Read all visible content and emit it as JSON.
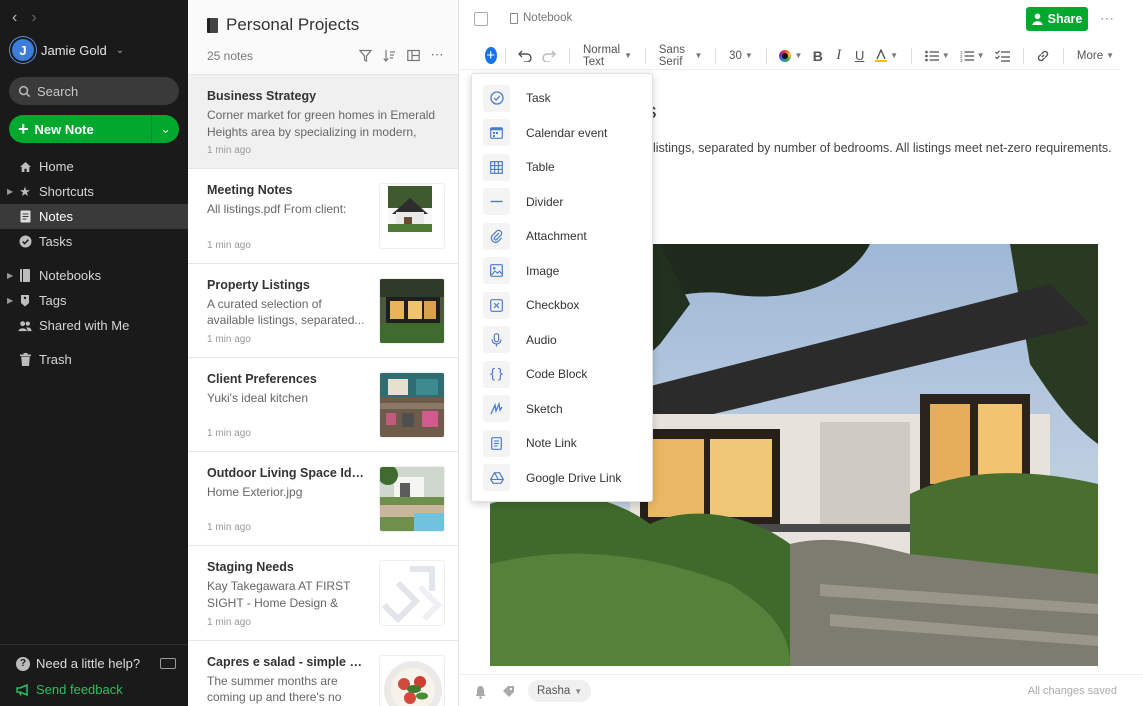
{
  "sidebar": {
    "user_name": "Jamie Gold",
    "avatar_initial": "J",
    "search_label": "Search",
    "new_note_label": "New Note",
    "nav": [
      {
        "label": "Home",
        "icon": "home-icon"
      },
      {
        "label": "Shortcuts",
        "icon": "star-icon"
      },
      {
        "label": "Notes",
        "icon": "notes-icon"
      },
      {
        "label": "Tasks",
        "icon": "tasks-icon"
      },
      {
        "label": "Notebooks",
        "icon": "notebook-icon"
      },
      {
        "label": "Tags",
        "icon": "tag-icon"
      },
      {
        "label": "Shared with Me",
        "icon": "people-icon"
      },
      {
        "label": "Trash",
        "icon": "trash-icon"
      }
    ],
    "help_label": "Need a little help?",
    "feedback_label": "Send feedback"
  },
  "note_list": {
    "title": "Personal Projects",
    "count": "25 notes",
    "notes": [
      {
        "title": "Business Strategy",
        "snippet": "Corner market for green homes in Emerald Heights area by specializing in modern, net...",
        "time": "1 min ago"
      },
      {
        "title": "Meeting Notes",
        "snippet": "All listings.pdf From client:",
        "time": "1 min ago"
      },
      {
        "title": "Property Listings",
        "snippet": "A curated selection of available listings, separated...",
        "time": "1 min ago"
      },
      {
        "title": "Client Preferences",
        "snippet": "Yuki's ideal kitchen",
        "time": "1 min ago"
      },
      {
        "title": "Outdoor Living Space Ideas",
        "snippet": "Home Exterior.jpg",
        "time": "1 min ago"
      },
      {
        "title": "Staging Needs",
        "snippet": "Kay Takegawara AT FIRST SIGHT - Home Design & Sta...",
        "time": "1 min ago"
      },
      {
        "title": "Capres e salad - simple and...",
        "snippet": "The summer months are coming up and  there's no",
        "time": ""
      }
    ]
  },
  "editor": {
    "notebook_crumb": "Notebook",
    "share_label": "Share",
    "toolbar": {
      "style": "Normal Text",
      "font": "Sans Serif",
      "size": "30",
      "more": "More"
    },
    "heading_fragment": "s",
    "body_text": "listings, separated by number of bedrooms. All listings meet net-zero requirements.",
    "footer": {
      "tag_chip": "Rasha",
      "saved_status": "All changes saved"
    }
  },
  "insert_menu": [
    {
      "label": "Task",
      "icon": "check-circle-icon"
    },
    {
      "label": "Calendar event",
      "icon": "calendar-icon"
    },
    {
      "label": "Table",
      "icon": "table-icon"
    },
    {
      "label": "Divider",
      "icon": "divider-icon"
    },
    {
      "label": "Attachment",
      "icon": "paperclip-icon"
    },
    {
      "label": "Image",
      "icon": "image-icon"
    },
    {
      "label": "Checkbox",
      "icon": "checkbox-icon"
    },
    {
      "label": "Audio",
      "icon": "microphone-icon"
    },
    {
      "label": "Code Block",
      "icon": "code-braces-icon"
    },
    {
      "label": "Sketch",
      "icon": "sketch-icon"
    },
    {
      "label": "Note Link",
      "icon": "note-link-icon"
    },
    {
      "label": "Google Drive Link",
      "icon": "google-drive-icon"
    }
  ],
  "colors": {
    "brand_green": "#00a82d",
    "sidebar_bg": "#1a1a1a",
    "accent_blue": "#1a73e8"
  }
}
